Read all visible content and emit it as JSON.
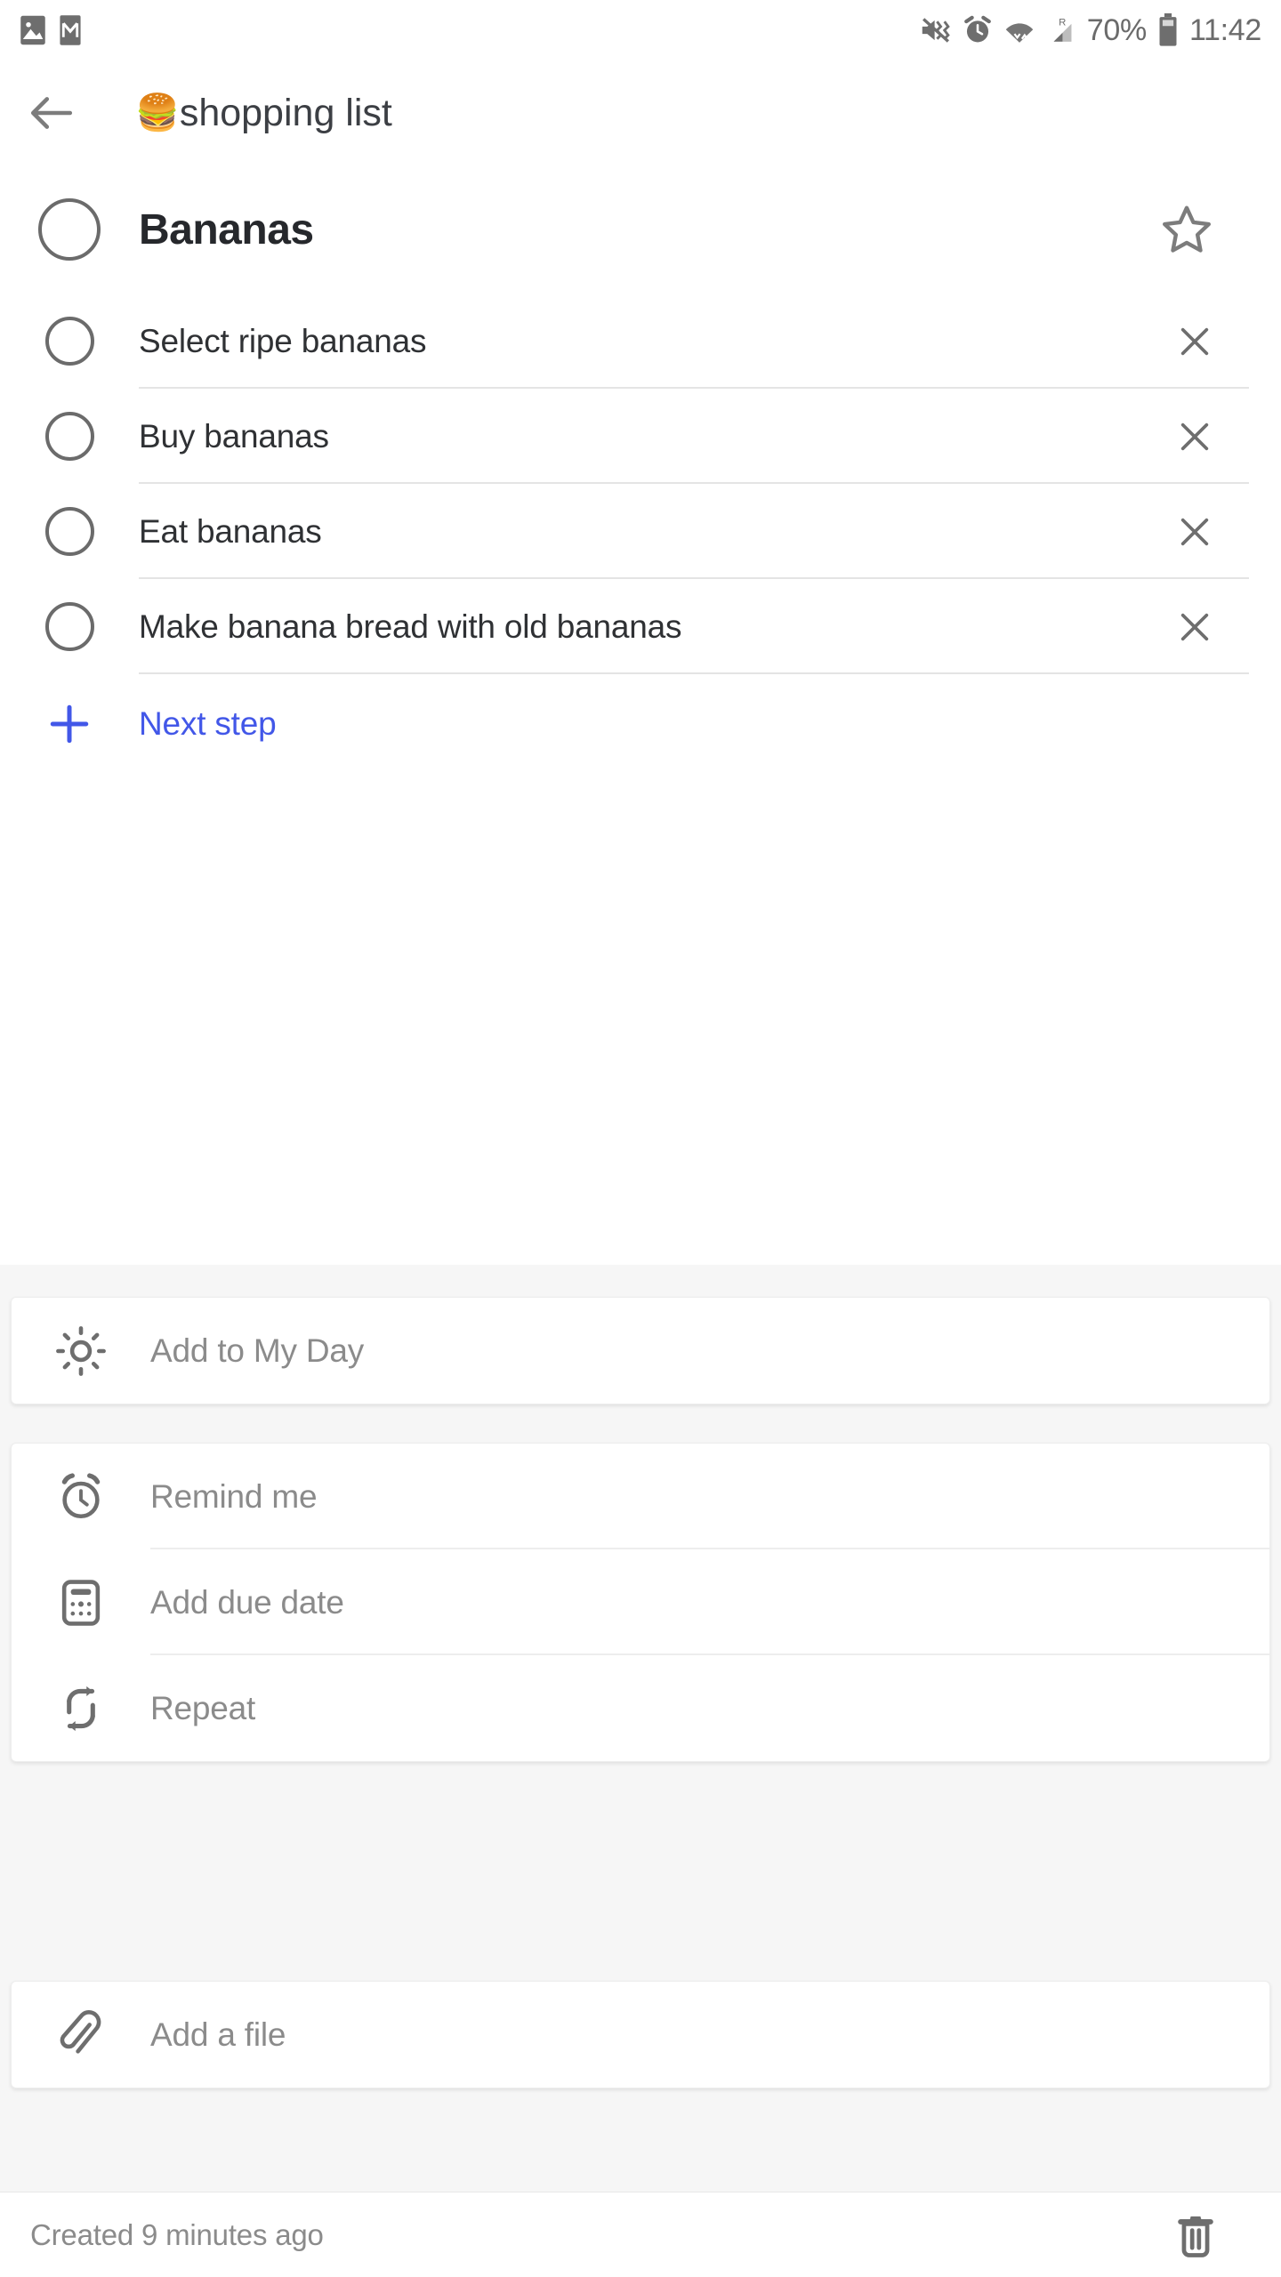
{
  "status_bar": {
    "left_icons": [
      {
        "name": "photos-icon",
        "glyph": "image"
      },
      {
        "name": "gmail-icon",
        "glyph": "mail"
      }
    ],
    "right_icons": [
      {
        "name": "vibrate-mute-icon",
        "glyph": "volume-off"
      },
      {
        "name": "alarm-icon",
        "glyph": "alarm"
      },
      {
        "name": "wifi-icon",
        "glyph": "wifi"
      },
      {
        "name": "cellular-roaming-icon",
        "glyph": "signal-r"
      },
      {
        "name": "battery-icon",
        "glyph": "battery"
      }
    ],
    "battery_percent": "70%",
    "clock": "11:42"
  },
  "app_bar": {
    "back_label": "back-arrow",
    "list_emoji": "🍔",
    "list_title": "shopping list"
  },
  "task": {
    "title": "Bananas",
    "checked": false,
    "starred": false,
    "star_icon": "star-outline-icon"
  },
  "steps": [
    {
      "label": "Select ripe bananas",
      "checked": false
    },
    {
      "label": "Buy bananas",
      "checked": false
    },
    {
      "label": "Eat bananas",
      "checked": false
    },
    {
      "label": "Make banana bread with old bananas",
      "checked": false
    }
  ],
  "next_step": {
    "label": "Next step",
    "icon": "plus-icon",
    "color": "#4257e8"
  },
  "option_cards": [
    {
      "rows": [
        {
          "label": "Add to My Day",
          "icon": "sun-icon"
        }
      ]
    },
    {
      "rows": [
        {
          "label": "Remind me",
          "icon": "alarm-clock-icon"
        },
        {
          "label": "Add due date",
          "icon": "calendar-icon"
        },
        {
          "label": "Repeat",
          "icon": "repeat-icon"
        }
      ]
    },
    {
      "rows": [
        {
          "label": "Add a file",
          "icon": "paperclip-icon"
        }
      ]
    }
  ],
  "footer": {
    "created_text": "Created 9 minutes ago",
    "delete_icon": "trash-icon"
  },
  "colors": {
    "accent_blue": "#4257e8",
    "text_primary": "#26282c",
    "text_secondary": "#8b8b8b",
    "icon_grey": "#6e6e6e",
    "page_grey": "#f6f6f6"
  }
}
